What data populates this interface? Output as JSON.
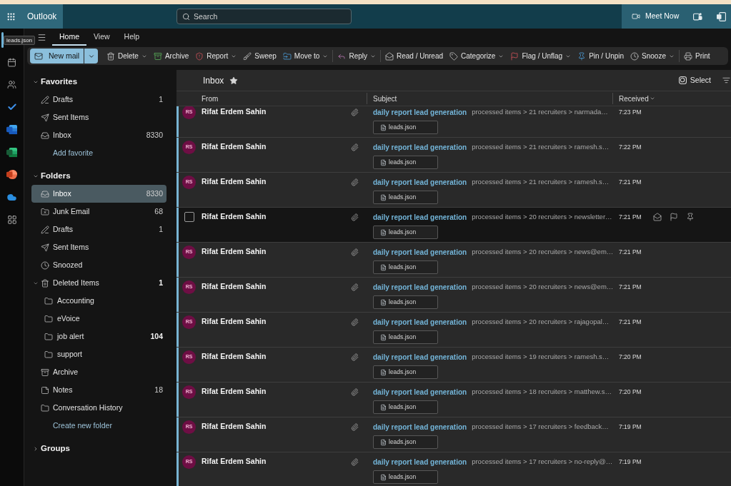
{
  "app_bar": {
    "app_name": "Outlook",
    "search": {
      "placeholder": "Search"
    },
    "meet_now": "Meet Now"
  },
  "tooltip": "leads.json",
  "rail": [
    {
      "kind": "mail",
      "selected": true
    },
    {
      "kind": "calendar",
      "selected": false
    },
    {
      "kind": "people",
      "selected": false
    },
    {
      "kind": "todo",
      "selected": false
    },
    {
      "kind": "word",
      "selected": false
    },
    {
      "kind": "excel",
      "selected": false
    },
    {
      "kind": "powerpoint",
      "selected": false
    },
    {
      "kind": "onedrive",
      "selected": false
    },
    {
      "kind": "apps",
      "selected": false
    }
  ],
  "tabs": [
    {
      "label": "Home",
      "selected": true
    },
    {
      "label": "View",
      "selected": false
    },
    {
      "label": "Help",
      "selected": false
    }
  ],
  "ribbon": {
    "new_mail": "New mail",
    "groups": [
      {
        "items": [
          {
            "kind": "delete",
            "label": "Delete",
            "dropdown": true
          },
          {
            "kind": "archive",
            "label": "Archive",
            "dropdown": false
          },
          {
            "kind": "report",
            "label": "Report",
            "dropdown": true
          },
          {
            "kind": "sweep",
            "label": "Sweep",
            "dropdown": false
          },
          {
            "kind": "move",
            "label": "Move to",
            "dropdown": true
          }
        ]
      },
      {
        "items": [
          {
            "kind": "reply",
            "label": "Reply",
            "dropdown": true
          }
        ]
      },
      {
        "items": [
          {
            "kind": "read",
            "label": "Read / Unread",
            "dropdown": false
          },
          {
            "kind": "categorize",
            "label": "Categorize",
            "dropdown": true
          },
          {
            "kind": "flag",
            "label": "Flag / Unflag",
            "dropdown": true
          },
          {
            "kind": "pin",
            "label": "Pin / Unpin",
            "dropdown": false
          },
          {
            "kind": "snooze",
            "label": "Snooze",
            "dropdown": true
          }
        ]
      },
      {
        "items": [
          {
            "kind": "print",
            "label": "Print",
            "dropdown": false
          }
        ]
      }
    ]
  },
  "folder_pane": {
    "sections": [
      {
        "title": "Favorites",
        "expanded": true,
        "items": [
          {
            "kind": "drafts",
            "label": "Drafts",
            "count": "1",
            "unread": false,
            "selected": false
          },
          {
            "kind": "sent",
            "label": "Sent Items",
            "selected": false
          },
          {
            "kind": "inbox",
            "label": "Inbox",
            "count": "8330",
            "unread": false,
            "selected": false
          }
        ],
        "link": "Add favorite"
      },
      {
        "title": "Folders",
        "expanded": true,
        "items": [
          {
            "kind": "inbox",
            "label": "Inbox",
            "count": "8330",
            "unread": false,
            "selected": true
          },
          {
            "kind": "junk",
            "label": "Junk Email",
            "count": "68",
            "unread": false,
            "selected": false
          },
          {
            "kind": "drafts",
            "label": "Drafts",
            "count": "1",
            "unread": false,
            "selected": false
          },
          {
            "kind": "sent",
            "label": "Sent Items",
            "selected": false
          },
          {
            "kind": "snoozed",
            "label": "Snoozed",
            "selected": false
          },
          {
            "kind": "deleted",
            "label": "Deleted Items",
            "count": "1",
            "unread": true,
            "selected": false,
            "expanded": true,
            "children": [
              {
                "kind": "folder",
                "label": "Accounting",
                "selected": false
              },
              {
                "kind": "folder",
                "label": "eVoice",
                "selected": false
              },
              {
                "kind": "folder",
                "label": "job alert",
                "count": "104",
                "unread": true,
                "selected": false
              },
              {
                "kind": "folder",
                "label": "support",
                "selected": false
              }
            ]
          },
          {
            "kind": "archive",
            "label": "Archive",
            "selected": false
          },
          {
            "kind": "notes",
            "label": "Notes",
            "count": "18",
            "unread": false,
            "selected": false
          },
          {
            "kind": "folder",
            "label": "Conversation History",
            "selected": false
          }
        ],
        "link": "Create new folder"
      },
      {
        "title": "Groups",
        "expanded": false
      }
    ]
  },
  "message_list": {
    "title": "Inbox",
    "favorite": true,
    "select": "Select",
    "columns": [
      {
        "label": "From",
        "sorted": false
      },
      {
        "label": "Subject",
        "sorted": false
      },
      {
        "label": "Received",
        "sorted": true
      }
    ],
    "rows": [
      {
        "initials": "RS",
        "sender": "Rifat Erdem Sahin",
        "subject": "daily report lead generation",
        "preview": "processed items > 21 recruiters > narmada…",
        "time": "7:23 PM",
        "attachment": "leads.json",
        "unread": true,
        "hovered": false,
        "selected": false
      },
      {
        "initials": "RS",
        "sender": "Rifat Erdem Sahin",
        "subject": "daily report lead generation",
        "preview": "processed items > 21 recruiters > ramesh.s…",
        "time": "7:22 PM",
        "attachment": "leads.json",
        "unread": true,
        "hovered": false,
        "selected": false
      },
      {
        "initials": "RS",
        "sender": "Rifat Erdem Sahin",
        "subject": "daily report lead generation",
        "preview": "processed items > 21 recruiters > ramesh.s…",
        "time": "7:21 PM",
        "attachment": "leads.json",
        "unread": true,
        "hovered": false,
        "selected": false
      },
      {
        "sender": "Rifat Erdem Sahin",
        "subject": "daily report lead generation",
        "preview": "processed items > 20 recruiters > newsletter…",
        "time": "7:21 PM",
        "attachment": "leads.json",
        "unread": true,
        "hovered": true,
        "selected": false
      },
      {
        "initials": "RS",
        "sender": "Rifat Erdem Sahin",
        "subject": "daily report lead generation",
        "preview": "processed items > 20 recruiters > news@em…",
        "time": "7:21 PM",
        "attachment": "leads.json",
        "unread": true,
        "hovered": false,
        "selected": false
      },
      {
        "initials": "RS",
        "sender": "Rifat Erdem Sahin",
        "subject": "daily report lead generation",
        "preview": "processed items > 20 recruiters > news@em…",
        "time": "7:21 PM",
        "attachment": "leads.json",
        "unread": true,
        "hovered": false,
        "selected": false
      },
      {
        "initials": "RS",
        "sender": "Rifat Erdem Sahin",
        "subject": "daily report lead generation",
        "preview": "processed items > 20 recruiters > rajagopal…",
        "time": "7:21 PM",
        "attachment": "leads.json",
        "unread": true,
        "hovered": false,
        "selected": false
      },
      {
        "initials": "RS",
        "sender": "Rifat Erdem Sahin",
        "subject": "daily report lead generation",
        "preview": "processed items > 19 recruiters > ramesh.s…",
        "time": "7:20 PM",
        "attachment": "leads.json",
        "unread": true,
        "hovered": false,
        "selected": false
      },
      {
        "initials": "RS",
        "sender": "Rifat Erdem Sahin",
        "subject": "daily report lead generation",
        "preview": "processed items > 18 recruiters > matthew.s…",
        "time": "7:20 PM",
        "attachment": "leads.json",
        "unread": true,
        "hovered": false,
        "selected": false
      },
      {
        "initials": "RS",
        "sender": "Rifat Erdem Sahin",
        "subject": "daily report lead generation",
        "preview": "processed items > 17 recruiters > feedback…",
        "time": "7:19 PM",
        "attachment": "leads.json",
        "unread": true,
        "hovered": false,
        "selected": false
      },
      {
        "initials": "RS",
        "sender": "Rifat Erdem Sahin",
        "subject": "daily report lead generation",
        "preview": "processed items > 17 recruiters > no-reply@…",
        "time": "7:19 PM",
        "attachment": "leads.json",
        "unread": true,
        "hovered": false,
        "selected": false
      }
    ]
  }
}
